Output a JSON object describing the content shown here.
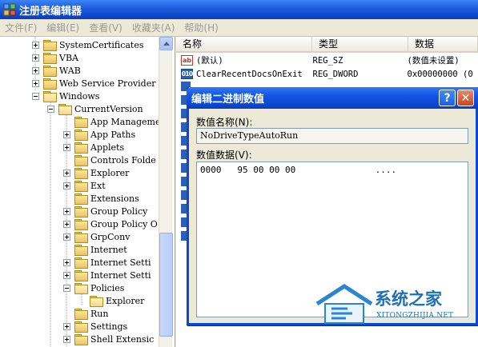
{
  "window": {
    "title": "注册表编辑器"
  },
  "menu": [
    {
      "label": "文件(F)"
    },
    {
      "label": "编辑(E)"
    },
    {
      "label": "查看(V)"
    },
    {
      "label": "收藏夹(A)"
    },
    {
      "label": "帮助(H)"
    }
  ],
  "tree": {
    "items": [
      {
        "label": "SystemCertificates",
        "expander": "plus"
      },
      {
        "label": "VBA",
        "expander": "plus"
      },
      {
        "label": "WAB",
        "expander": "plus"
      },
      {
        "label": "Web Service Provider",
        "expander": "plus"
      },
      {
        "label": "Windows",
        "expander": "minus"
      },
      {
        "label": "CurrentVersion",
        "expander": "minus"
      },
      {
        "label": "App Management",
        "expander": "none"
      },
      {
        "label": "App Paths",
        "expander": "plus"
      },
      {
        "label": "Applets",
        "expander": "plus"
      },
      {
        "label": "Controls Folde",
        "expander": "none"
      },
      {
        "label": "Explorer",
        "expander": "plus"
      },
      {
        "label": "Ext",
        "expander": "plus"
      },
      {
        "label": "Extensions",
        "expander": "none"
      },
      {
        "label": "Group Policy",
        "expander": "plus"
      },
      {
        "label": "Group Policy O",
        "expander": "plus"
      },
      {
        "label": "GrpConv",
        "expander": "plus"
      },
      {
        "label": "Internet",
        "expander": "none"
      },
      {
        "label": "Internet Setti",
        "expander": "plus"
      },
      {
        "label": "Internet Setti",
        "expander": "plus"
      },
      {
        "label": "Policies",
        "expander": "minus"
      },
      {
        "label": "Explorer",
        "expander": "none"
      },
      {
        "label": "Run",
        "expander": "none"
      },
      {
        "label": "Settings",
        "expander": "plus"
      },
      {
        "label": "Shell Extensic",
        "expander": "plus"
      }
    ]
  },
  "list": {
    "columns": [
      {
        "label": "名称"
      },
      {
        "label": "类型"
      },
      {
        "label": "数据"
      }
    ],
    "rows": [
      {
        "name": "(默认)",
        "type": "REG_SZ",
        "data": "(数值未设置)",
        "icon": "ab"
      },
      {
        "name": "ClearRecentDocsOnExit",
        "type": "REG_DWORD",
        "data": "0x00000000 (0",
        "icon": "010"
      }
    ]
  },
  "dialog": {
    "title": "编辑二进制数值",
    "help_label": "?",
    "close_label": "✕",
    "name_label": "数值名称(N):",
    "name_value": "NoDriveTypeAutoRun",
    "data_label": "数值数据(V):",
    "hex": {
      "offset": "0000",
      "bytes": "95 00 00 00",
      "ascii": "...."
    }
  },
  "watermark": {
    "text": "系统之家",
    "subtext": "XITONGZHIJIA.NET"
  }
}
